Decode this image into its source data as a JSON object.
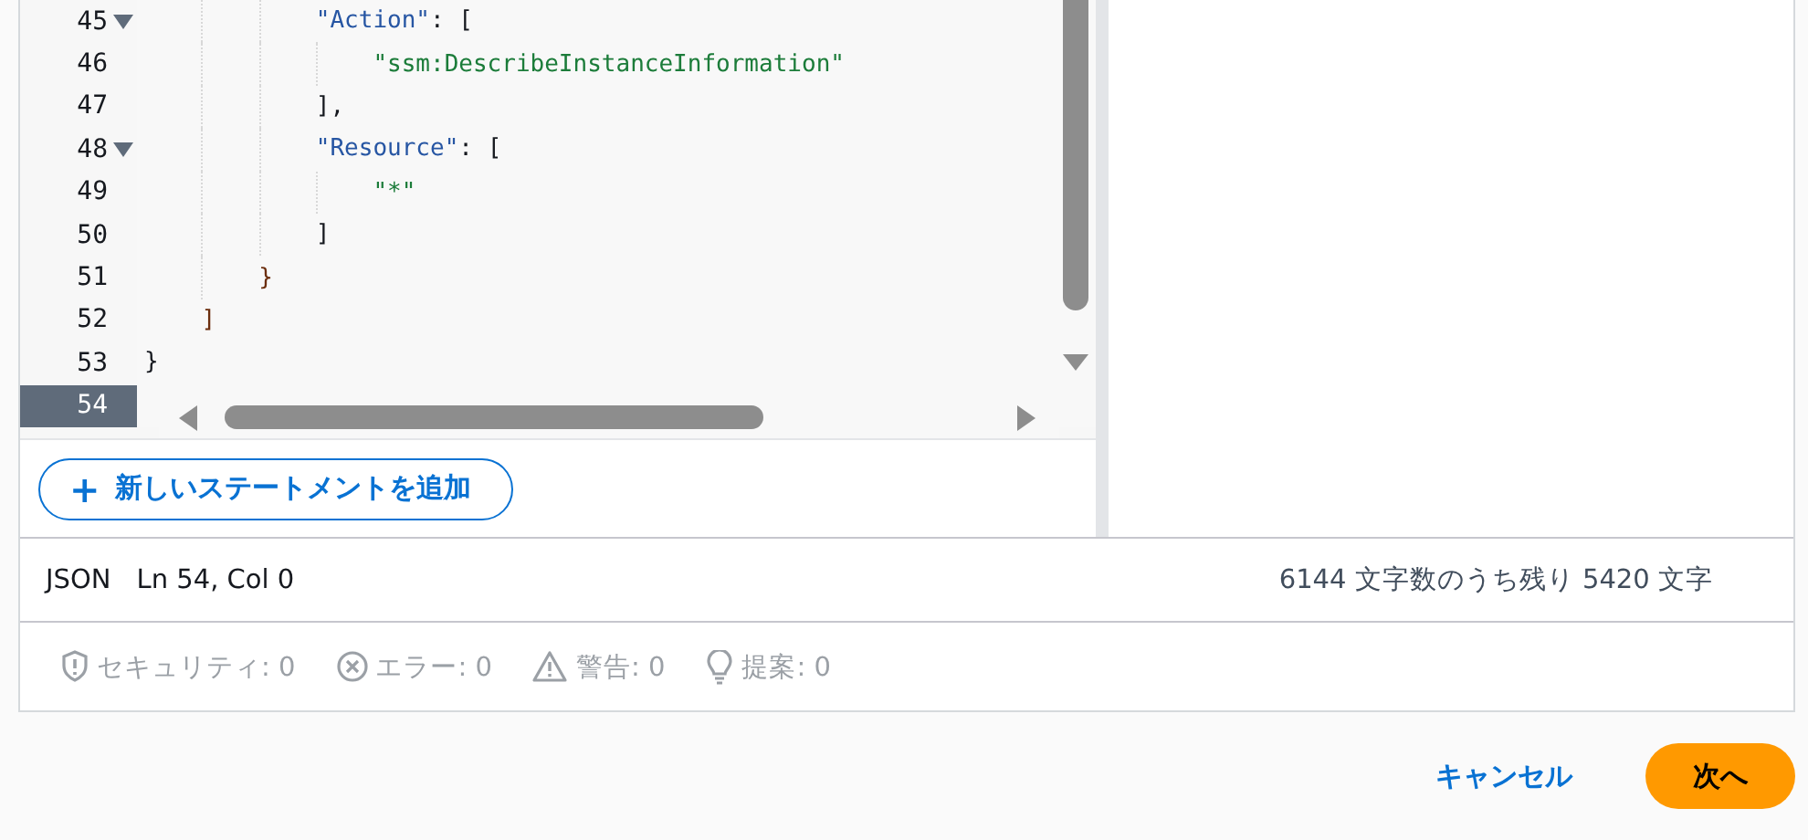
{
  "editor": {
    "lines": [
      {
        "children": [
          {
            "children": [
              {
                "children": [
                  {
                    "number": "45",
                    "foldable": true,
                    "current": false,
                    "tokens": [
                      {
                        "kind": "key",
                        "text": "\"Action\""
                      },
                      {
                        "kind": "punct",
                        "text": ": ["
                      }
                    ],
                    "children": [
                      {
                        "number": "46",
                        "foldable": false,
                        "current": false,
                        "tokens": [
                          {
                            "kind": "string",
                            "text": "\"ssm:DescribeInstanceInformation\""
                          }
                        ]
                      }
                    ]
                  },
                  {
                    "number": "47",
                    "foldable": false,
                    "current": false,
                    "tokens": [
                      {
                        "kind": "punct",
                        "text": "],"
                      }
                    ]
                  },
                  {
                    "number": "48",
                    "foldable": true,
                    "current": false,
                    "tokens": [
                      {
                        "kind": "key",
                        "text": "\"Resource\""
                      },
                      {
                        "kind": "punct",
                        "text": ": ["
                      }
                    ],
                    "children": [
                      {
                        "number": "49",
                        "foldable": false,
                        "current": false,
                        "tokens": [
                          {
                            "kind": "string",
                            "text": "\"*\""
                          }
                        ]
                      }
                    ]
                  },
                  {
                    "number": "50",
                    "foldable": false,
                    "current": false,
                    "tokens": [
                      {
                        "kind": "punct",
                        "text": "]"
                      }
                    ]
                  }
                ]
              },
              {
                "number": "51",
                "foldable": false,
                "current": false,
                "tokens": [
                  {
                    "kind": "bracket",
                    "text": "}"
                  }
                ]
              }
            ]
          },
          {
            "number": "52",
            "foldable": false,
            "current": false,
            "tokens": [
              {
                "kind": "bracket",
                "text": "]"
              }
            ]
          }
        ]
      },
      {
        "number": "53",
        "foldable": false,
        "current": false,
        "tokens": [
          {
            "kind": "punct",
            "text": "}"
          }
        ]
      },
      {
        "number": "54",
        "foldable": false,
        "current": true
      }
    ]
  },
  "add_statement_button": {
    "icon": "+",
    "label": "新しいステートメントを追加"
  },
  "status_bar": {
    "language": "JSON",
    "position": "Ln 54, Col 0",
    "char_count": "6144 文字数のうち残り 5420 文字"
  },
  "issues": [
    {
      "kind": "security",
      "label": "セキュリティ: 0"
    },
    {
      "kind": "error",
      "label": "エラー: 0"
    },
    {
      "kind": "warning",
      "label": "警告: 0"
    },
    {
      "kind": "suggestion",
      "label": "提案: 0"
    }
  ],
  "footer": {
    "cancel": "キャンセル",
    "next": "次へ"
  }
}
